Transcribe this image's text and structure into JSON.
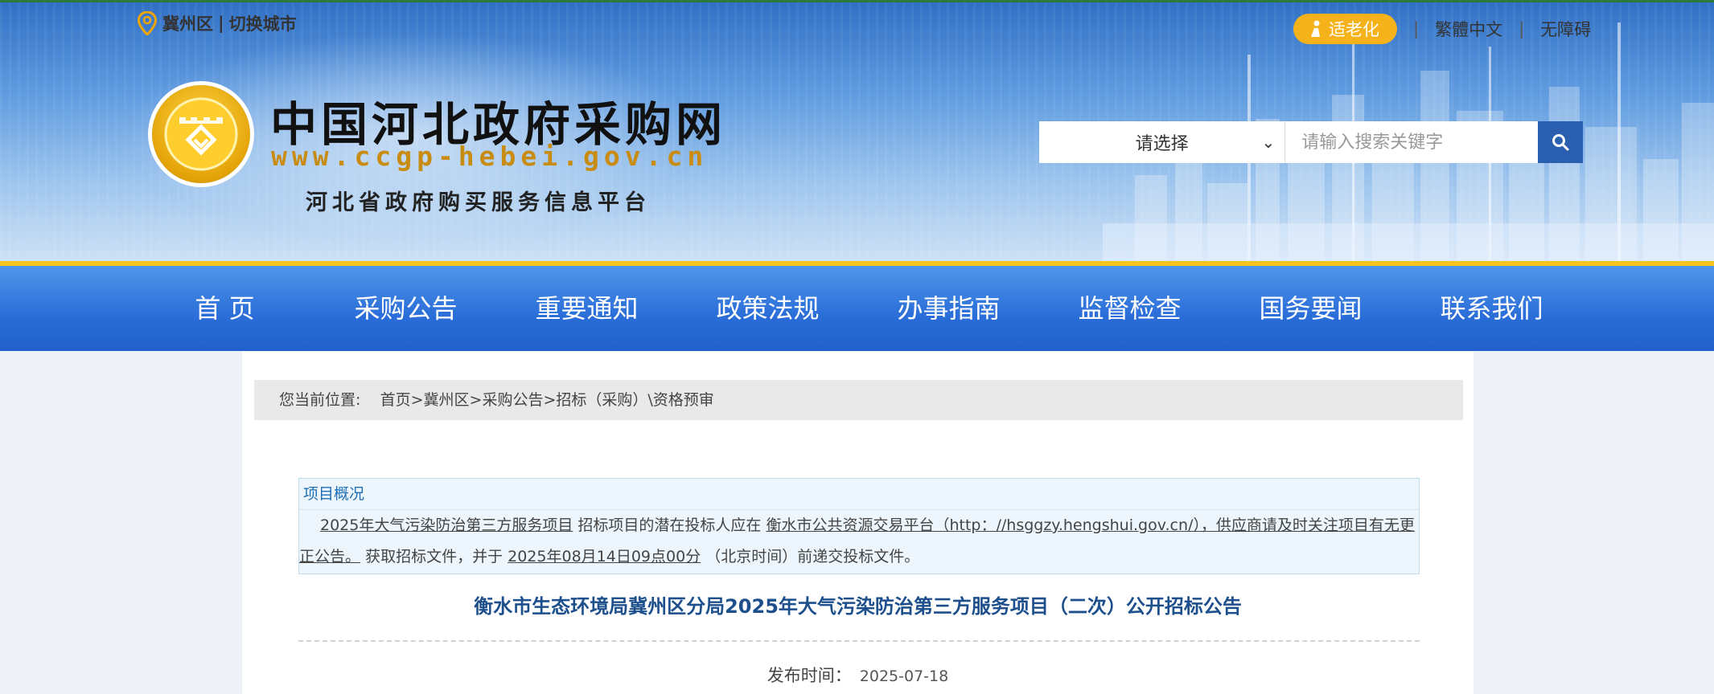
{
  "header": {
    "location": "冀州区",
    "separator": "|",
    "switch_city": "切换城市",
    "elder_mode": "适老化",
    "traditional": "繁體中文",
    "accessibility": "无障碍",
    "site_title": "中国河北政府采购网",
    "site_url": "www.ccgp-hebei.gov.cn",
    "site_subtitle": "河北省政府购买服务信息平台"
  },
  "search": {
    "select_value": "请选择",
    "placeholder": "请输入搜索关键字",
    "icon": "search-icon"
  },
  "nav": {
    "items": [
      "首 页",
      "采购公告",
      "重要通知",
      "政策法规",
      "办事指南",
      "监督检查",
      "国务要闻",
      "联系我们"
    ]
  },
  "breadcrumb": {
    "prefix": "您当前位置:",
    "items": [
      "首页",
      "冀州区",
      "采购公告",
      "招标（采购）\\资格预审"
    ],
    "separator": ">"
  },
  "overview": {
    "heading": "项目概况",
    "project_name": "2025年大气污染防治第三方服务项目",
    "text1": "招标项目的潜在投标人应在",
    "platform": "衡水市公共资源交易平台（http：//hsggzy.hengshui.gov.cn/），供应商请及时关注项目有无更正公告。",
    "text2": "获取招标文件，并于",
    "deadline": "2025年08月14日09点00分",
    "text3": "（北京时间）前递交投标文件。"
  },
  "notice": {
    "title": "衡水市生态环境局冀州区分局2025年大气污染防治第三方服务项目（二次）公开招标公告",
    "publish_label": "发布时间：",
    "publish_date": "2025-07-18"
  },
  "colors": {
    "nav_blue": "#2a6dd8",
    "nav_gold": "#f5c51c",
    "elder_btn": "#f6b21b",
    "search_btn": "#2a5fb0",
    "title_blue": "#1d4f8c"
  }
}
